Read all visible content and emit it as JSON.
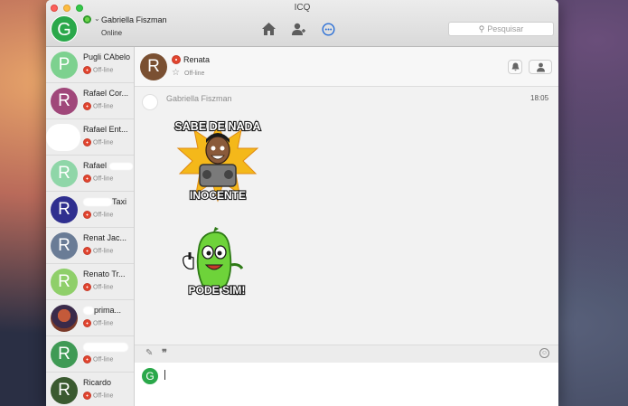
{
  "window": {
    "title": "ICQ"
  },
  "me": {
    "avatar_letter": "G",
    "avatar_color": "#2aa84a",
    "name": "Gabriella Fiszman",
    "status": "Online"
  },
  "nav": {
    "icons": [
      "home-icon",
      "add-contact-icon",
      "chats-icon"
    ]
  },
  "search": {
    "placeholder": "Pesquisar"
  },
  "contacts": [
    {
      "letter": "P",
      "color": "#7dd18f",
      "name": "Pugli CAbelo",
      "status": "Off-line"
    },
    {
      "letter": "R",
      "color": "#a0477a",
      "name": "Rafael Cor...",
      "status": "Off-line"
    },
    {
      "letter": "",
      "color": "#ffffff",
      "name": "Rafael Ent...",
      "status": "Off-line"
    },
    {
      "letter": "R",
      "color": "#8fd6a8",
      "name": "Rafael",
      "status": "Off-line"
    },
    {
      "letter": "R",
      "color": "#2f2f8f",
      "name": "Taxi",
      "status": "Off-line"
    },
    {
      "letter": "R",
      "color": "#6a7c96",
      "name": "Renat Jac...",
      "status": "Off-line"
    },
    {
      "letter": "R",
      "color": "#8fcf6a",
      "name": "Renato Tr...",
      "status": "Off-line"
    },
    {
      "letter": "",
      "color": "#7a3a2a",
      "name": "prima...",
      "status": "Off-line"
    },
    {
      "letter": "R",
      "color": "#3f9a55",
      "name": "",
      "status": "Off-line"
    },
    {
      "letter": "R",
      "color": "#3a5a30",
      "name": "Ricardo",
      "status": "Off-line"
    }
  ],
  "chat": {
    "contact_letter": "R",
    "contact_color": "#7a5032",
    "contact_name": "Renata",
    "contact_status": "Off-line",
    "message_sender": "Gabriella Fiszman",
    "message_time": "18:05",
    "sticker1_text_top": "SABE DE NADA",
    "sticker1_text_bottom": "INOCENTE",
    "sticker2_text": "PODE SIM!"
  },
  "composer": {
    "avatar_letter": "G",
    "value": ""
  },
  "colors": {
    "status_offline": "#e1452f",
    "status_online": "#4bbf3a",
    "accent": "#2a6fd6"
  }
}
